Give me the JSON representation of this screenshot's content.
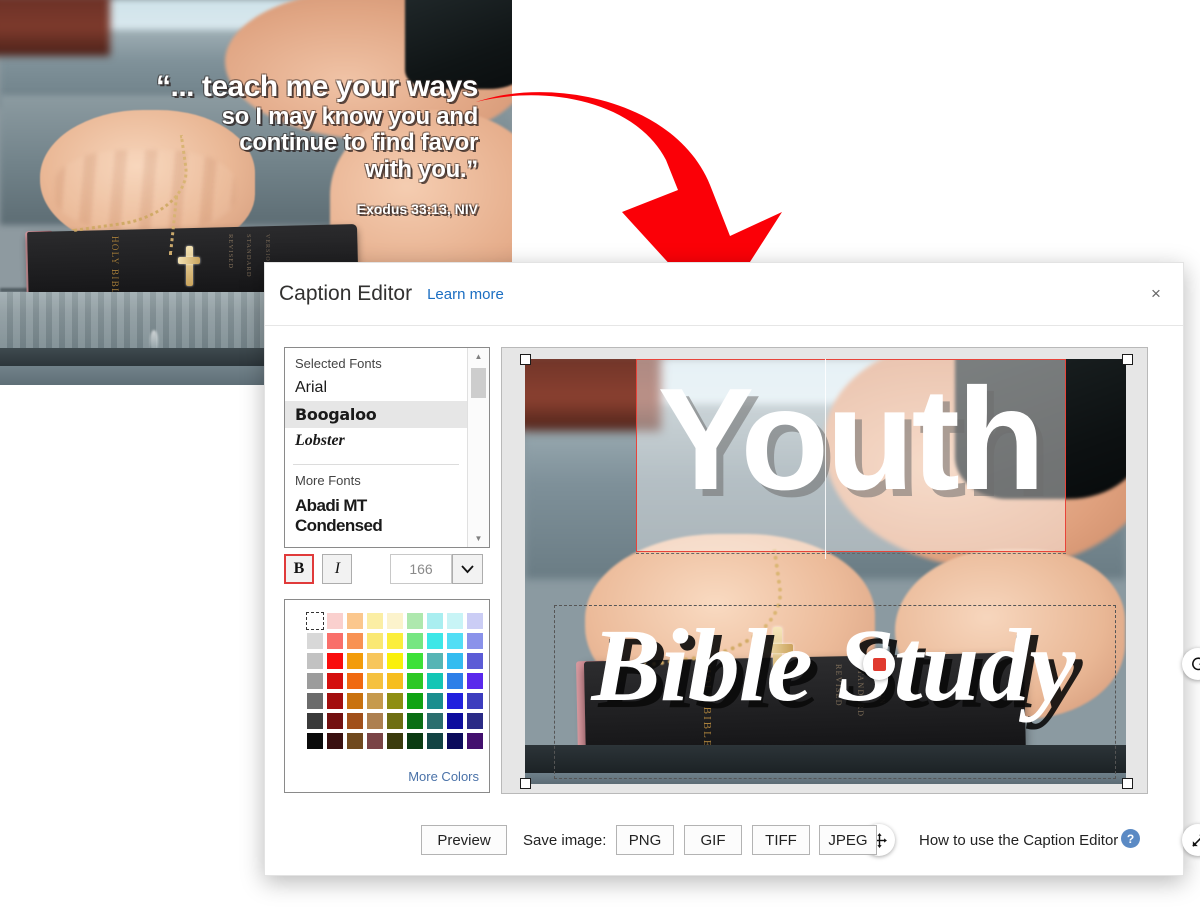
{
  "poster": {
    "quote_line1": "“... teach me your ways",
    "quote_line2": "so I may know you and",
    "quote_line3": "continue to find favor",
    "quote_line4": "with you.”",
    "reference": "Exodus 33:13, NIV",
    "bible_spine_1": "HOLY BIBLE",
    "bible_spine_2": "REVISED",
    "bible_spine_3": "STANDARD",
    "bible_spine_4": "VERSION",
    "arrow_color": "#fb0007"
  },
  "dialog": {
    "title": "Caption Editor",
    "learn_more": "Learn more",
    "close_label": "×"
  },
  "fonts": {
    "selected_group_label": "Selected Fonts",
    "more_group_label": "More Fonts",
    "items": [
      {
        "label": "Arial",
        "selected": false
      },
      {
        "label": "Boogaloo",
        "selected": true
      },
      {
        "label": "Lobster",
        "selected": false
      }
    ],
    "more_items": [
      {
        "label": "Abadi MT Condensed"
      }
    ],
    "bold_label": "B",
    "italic_label": "I",
    "bold_active": true,
    "size_value": "166",
    "size_caret": "⌄",
    "scroll_up": "▲",
    "scroll_down": "▼"
  },
  "colors": {
    "more_colors_label": "More Colors",
    "none_swatch": "transparent",
    "swatches": [
      "#FFFFFF",
      "#FAD0CE",
      "#FBC78D",
      "#FBEEA4",
      "#FCF3CC",
      "#AEE8AE",
      "#A9EEF0",
      "#C8F4F6",
      "#CBCDF5",
      "#D8D8D8",
      "#F96F6A",
      "#F89253",
      "#FAE873",
      "#FBEE3B",
      "#76E682",
      "#3DE7E7",
      "#52DEF5",
      "#8A92EA",
      "#C2C2C2",
      "#F90C0C",
      "#F39C0B",
      "#F7C65B",
      "#FAF00B",
      "#3DE139",
      "#56B5B5",
      "#34BCF0",
      "#5C5CD6",
      "#9C9C9C",
      "#D40F0E",
      "#F06A10",
      "#F5C13F",
      "#F6BE1E",
      "#2DC825",
      "#13C6B5",
      "#2D7FE8",
      "#5A29EC",
      "#6B6B6B",
      "#A30E0E",
      "#C9720F",
      "#C69A4D",
      "#8E8E12",
      "#10A314",
      "#1A8E8E",
      "#2121DE",
      "#3D3DBE",
      "#3A3A3A",
      "#731010",
      "#A1501A",
      "#AD8050",
      "#6E6E12",
      "#0A6E14",
      "#2B6E6E",
      "#0D0D9E",
      "#2B2B86",
      "#0A0A0A",
      "#3A1010",
      "#70491E",
      "#7A4446",
      "#3B3B0D",
      "#0B3B12",
      "#134444",
      "#0B0B5C",
      "#43106E"
    ]
  },
  "canvas": {
    "caption_top": "Youth",
    "caption_bottom": "Bible Study",
    "rotate_icon": "↻",
    "move_icon": "✤",
    "resize_icon": "⤡"
  },
  "footer": {
    "preview_label": "Preview",
    "save_image_label": "Save image:",
    "formats": [
      "PNG",
      "GIF",
      "TIFF",
      "JPEG"
    ],
    "howto_label": "How to use the Caption Editor",
    "help_icon_label": "?"
  }
}
